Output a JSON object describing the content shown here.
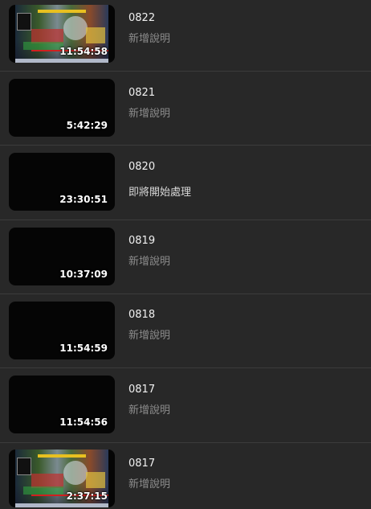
{
  "videos": [
    {
      "title": "0822",
      "description": "新增說明",
      "duration": "11:54:58",
      "thumbnail": "game-screenshot",
      "processing": false
    },
    {
      "title": "0821",
      "description": "新增說明",
      "duration": "5:42:29",
      "thumbnail": "black",
      "processing": false
    },
    {
      "title": "0820",
      "description": "即將開始處理",
      "duration": "23:30:51",
      "thumbnail": "black",
      "processing": true
    },
    {
      "title": "0819",
      "description": "新增說明",
      "duration": "10:37:09",
      "thumbnail": "black",
      "processing": false
    },
    {
      "title": "0818",
      "description": "新增說明",
      "duration": "11:54:59",
      "thumbnail": "black",
      "processing": false
    },
    {
      "title": "0817",
      "description": "新增說明",
      "duration": "11:54:56",
      "thumbnail": "black",
      "processing": false
    },
    {
      "title": "0817",
      "description": "新增說明",
      "duration": "2:37:15",
      "thumbnail": "game-screenshot",
      "processing": false
    }
  ]
}
